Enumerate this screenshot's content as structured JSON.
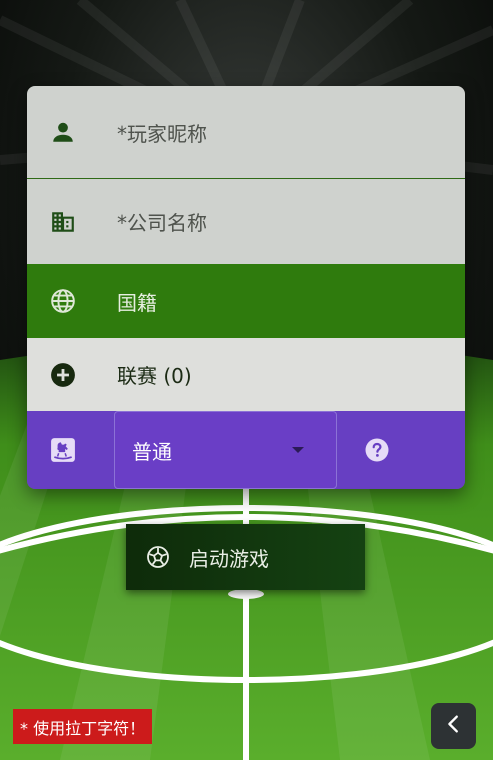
{
  "form": {
    "nickname_placeholder": "*玩家昵称",
    "company_placeholder": "*公司名称",
    "nationality_label": "国籍",
    "league_label": "联赛 (0)",
    "difficulty": {
      "selected": "普通"
    }
  },
  "start_button": {
    "label": "启动游戏"
  },
  "warning": {
    "text": "* 使用拉丁字符！"
  },
  "icons": {
    "nickname": "person-icon",
    "company": "building-icon",
    "nationality": "globe-icon",
    "league": "add-circle-icon",
    "difficulty": "rocking-horse-icon",
    "help": "help-icon",
    "start": "soccer-ball-icon",
    "back": "chevron-left-icon"
  },
  "colors": {
    "nationality_row": "#2f7b0d",
    "difficulty_row": "#673fc2",
    "warning": "#cc1b1b"
  }
}
